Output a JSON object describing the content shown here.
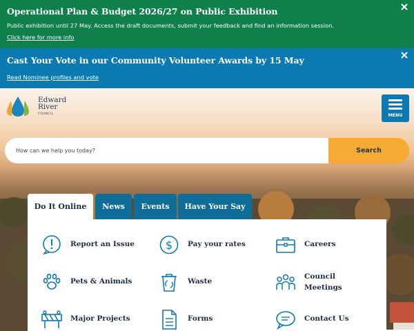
{
  "alerts": [
    {
      "title": "Operational Plan & Budget 2026/27 on Public Exhibition",
      "description": "Public exhibition until 27 May. Access the draft documents, submit your feedback and find an information session.",
      "link": "Click here for more info"
    },
    {
      "title": "Cast Your Vote in our Community Volunteer Awards by 15 May",
      "link": "Read Nominee profiles and vote"
    }
  ],
  "logo": {
    "line1": "Edward",
    "line2": "River",
    "line3": "COUNCIL"
  },
  "menu": {
    "label": "MENU"
  },
  "search": {
    "placeholder": "How can we help you today?",
    "button": "Search"
  },
  "tabs": [
    "Do It Online",
    "News",
    "Events",
    "Have Your Say"
  ],
  "quick_links": [
    {
      "label": "Report an Issue",
      "icon": "alert-circle-icon"
    },
    {
      "label": "Pay your rates",
      "icon": "dollar-circle-icon"
    },
    {
      "label": "Careers",
      "icon": "briefcase-icon"
    },
    {
      "label": "Pets & Animals",
      "icon": "paw-icon"
    },
    {
      "label": "Waste",
      "icon": "recycle-bin-icon"
    },
    {
      "label": "Council Meetings",
      "icon": "people-group-icon"
    },
    {
      "label": "Major Projects",
      "icon": "road-barrier-icon"
    },
    {
      "label": "Forms",
      "icon": "document-icon"
    },
    {
      "label": "Contact Us",
      "icon": "chat-bubble-icon"
    }
  ],
  "colors": {
    "green_alert": "#0f7f4c",
    "blue_alert": "#0a7ab0",
    "search_button": "#f5aa33",
    "tab": "#0f6d9a",
    "navy_text": "#1d2d44"
  }
}
